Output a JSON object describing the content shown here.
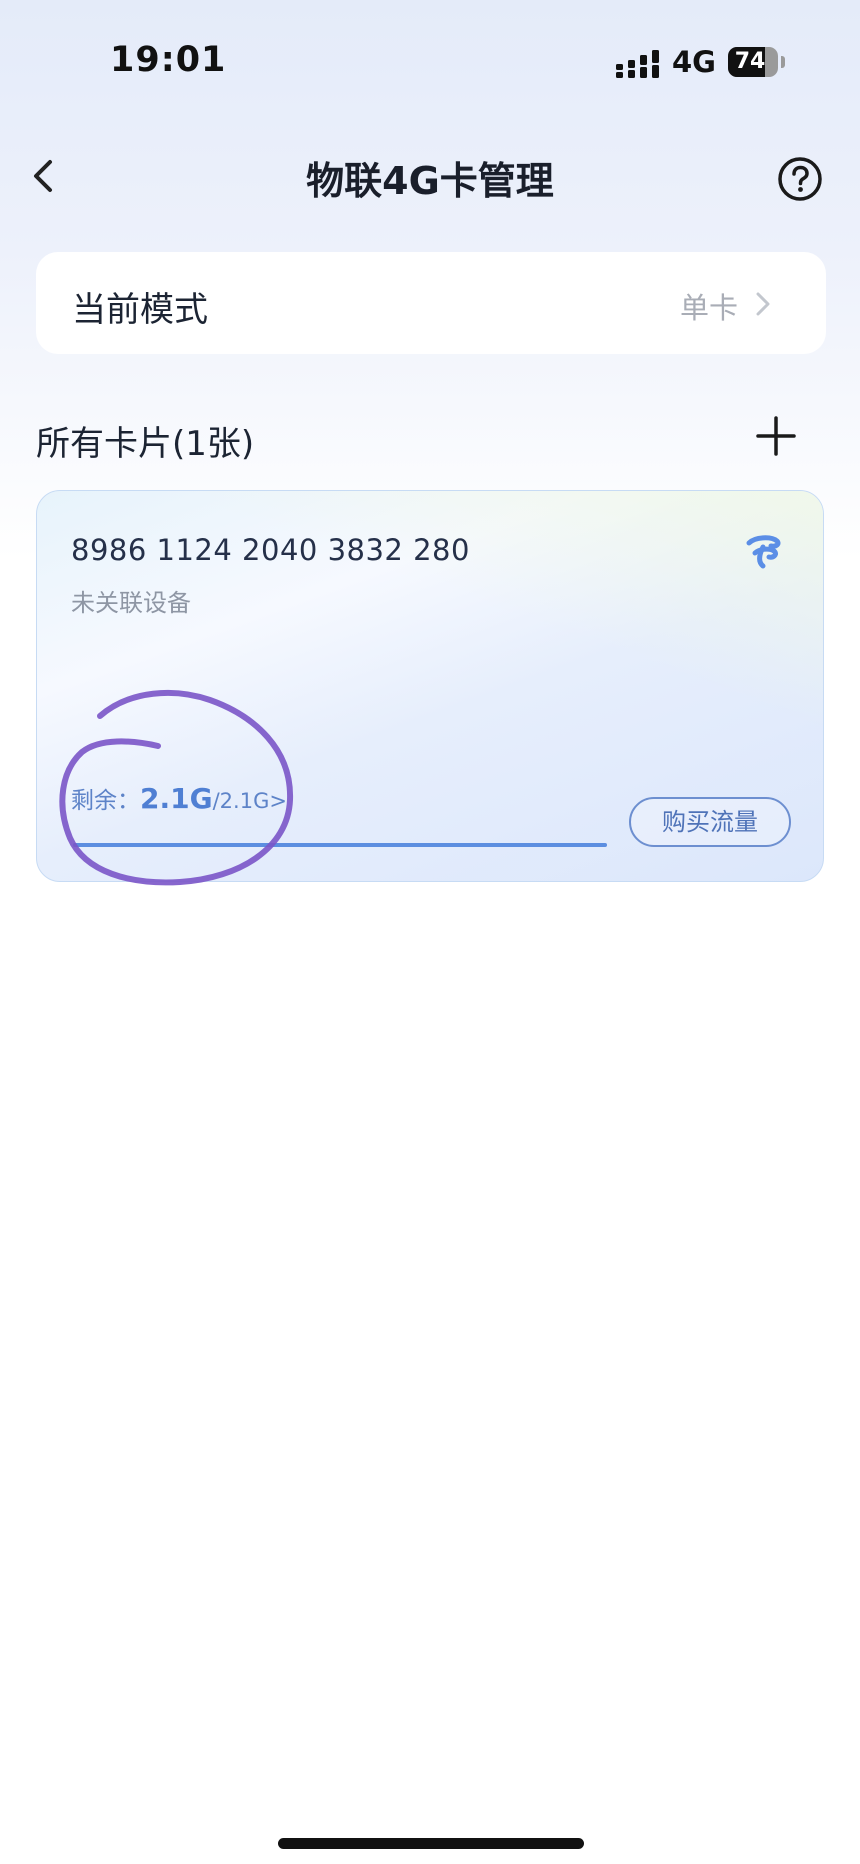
{
  "status_bar": {
    "time": "19:01",
    "network": "4G",
    "battery_percent": "74",
    "battery_level": 0.74
  },
  "header": {
    "title": "物联4G卡管理",
    "back_icon": "chevron-left-icon",
    "help_icon": "question-circle-icon"
  },
  "mode_card": {
    "label": "当前模式",
    "value": "单卡",
    "chevron_icon": "chevron-right-icon"
  },
  "cards_section": {
    "title": "所有卡片(1张)",
    "add_icon": "plus-icon"
  },
  "sim_card": {
    "number": "8986 1124 2040 3832 280",
    "device_status": "未关联设备",
    "carrier_icon": "china-telecom-logo-icon",
    "remaining_label": "剩余：",
    "remaining_value": "2.1G",
    "remaining_total": "/2.1G>",
    "usage_fraction": 1.0,
    "buy_button_label": "购买流量"
  },
  "colors": {
    "accent": "#4f7fd3",
    "annotation": "#7a55c8",
    "card_border": "#c7dbf4"
  }
}
